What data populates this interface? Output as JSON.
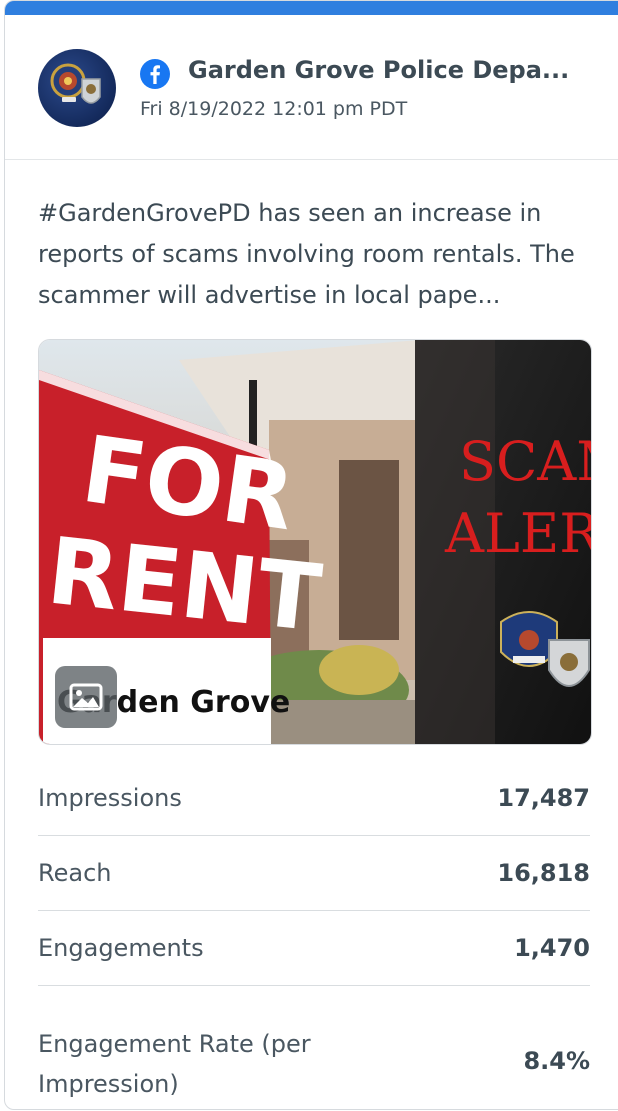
{
  "post": {
    "page_name": "Garden Grove Police Depa...",
    "platform_icon": "facebook-icon",
    "timestamp": "Fri 8/19/2022 12:01 pm PDT",
    "text": "#GardenGrovePD has seen an increase in reports of scams involving room rentals. The scammer will advertise in local pape...",
    "media": {
      "sign_line1": "FOR",
      "sign_line2": "RENT",
      "sign_bottom": "Garden Grove",
      "alert_line1": "SCAM",
      "alert_line2": "ALERT",
      "type_icon": "image-icon"
    }
  },
  "colors": {
    "accent": "#2f7fdf",
    "facebook": "#1877f2",
    "text": "#3c4a54"
  },
  "metrics": [
    {
      "label": "Impressions",
      "value": "17,487"
    },
    {
      "label": "Reach",
      "value": "16,818"
    },
    {
      "label": "Engagements",
      "value": "1,470"
    },
    {
      "label": "Engagement Rate (per Impression)",
      "value": "8.4%"
    }
  ]
}
